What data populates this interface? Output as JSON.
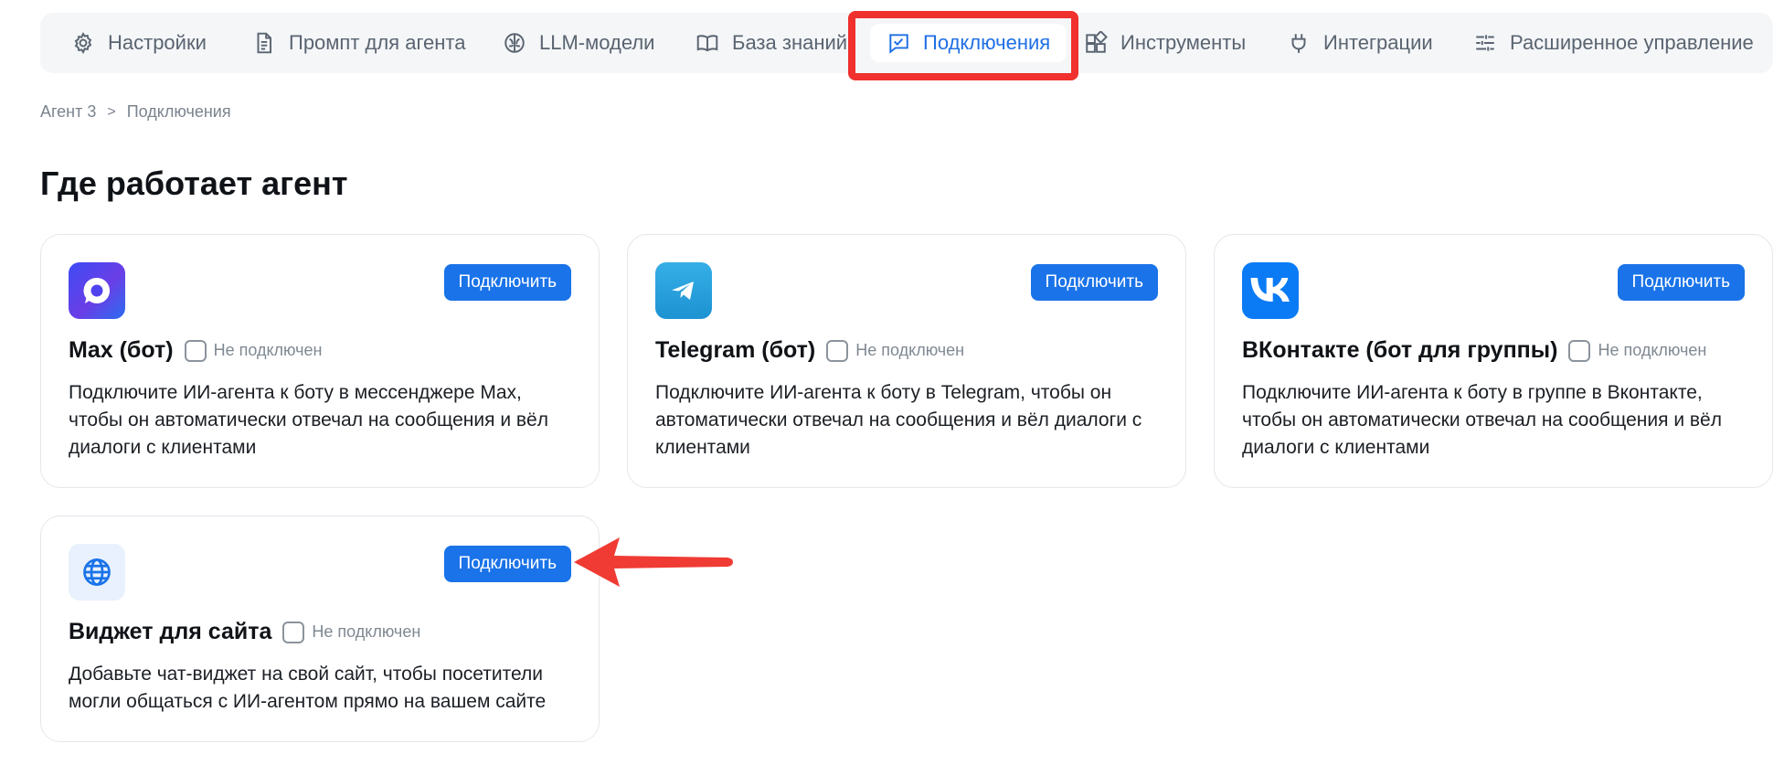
{
  "tabs": [
    {
      "label": "Настройки",
      "icon": "gear-icon"
    },
    {
      "label": "Промпт для агента",
      "icon": "document-icon"
    },
    {
      "label": "LLM-модели",
      "icon": "brain-icon"
    },
    {
      "label": "База знаний",
      "icon": "book-icon"
    },
    {
      "label": "Подключения",
      "icon": "chat-check-icon",
      "active": true
    },
    {
      "label": "Инструменты",
      "icon": "blocks-icon"
    },
    {
      "label": "Интеграции",
      "icon": "plug-icon"
    },
    {
      "label": "Расширенное управление",
      "icon": "sliders-icon"
    }
  ],
  "breadcrumb": {
    "root": "Агент 3",
    "separator": ">",
    "current": "Подключения"
  },
  "page_title": "Где работает агент",
  "connect_label": "Подключить",
  "status_label": "Не подключен",
  "cards": [
    {
      "name": "Max (бот)",
      "icon": "max-logo-icon",
      "description": "Подключите ИИ-агента к боту в мессенджере Max, чтобы он автоматически отвечал на сообщения и вёл диалоги с клиентами"
    },
    {
      "name": "Telegram (бот)",
      "icon": "telegram-logo-icon",
      "description": "Подключите ИИ-агента к боту в Telegram, чтобы он автоматически отвечал на сообщения и вёл диалоги с клиентами"
    },
    {
      "name": "ВКонтакте (бот для группы)",
      "icon": "vk-logo-icon",
      "description": "Подключите ИИ-агента к боту в группе в Вконтакте, чтобы он автоматически отвечал на сообщения и вёл диалоги с клиентами"
    },
    {
      "name": "Виджет для сайта",
      "icon": "globe-icon",
      "description": "Добавьте чат-виджет на свой сайт, чтобы посетители могли общаться с ИИ-агентом прямо на вашем сайте"
    }
  ],
  "colors": {
    "accent": "#1a73e8",
    "highlight": "#f0312e",
    "arrow": "#ef3b33"
  }
}
